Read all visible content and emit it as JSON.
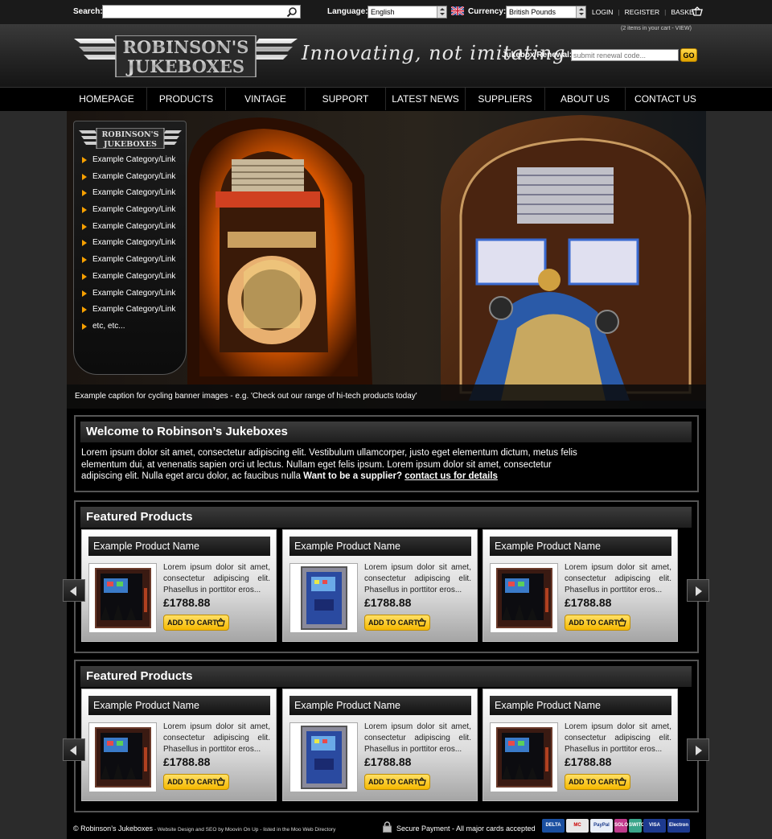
{
  "topbar": {
    "search_label": "Search:",
    "search_value": "",
    "language_label": "Language:",
    "language_value": "English",
    "currency_label": "Currency:",
    "currency_value": "British Pounds",
    "login": "LOGIN",
    "register": "REGISTER",
    "basket": "BASKET"
  },
  "header": {
    "cart_note": "(2 items in your cart - VIEW)",
    "logo_line1": "ROBINSON'S",
    "logo_line2": "JUKEBOXES",
    "tagline": "Innovating, not imitating",
    "renewal_label": "Jukebox Renewal:",
    "renewal_placeholder": "submit renewal code...",
    "go_label": "GO"
  },
  "nav": {
    "items": [
      {
        "label": "HOMEPAGE"
      },
      {
        "label": "PRODUCTS"
      },
      {
        "label": "VINTAGE"
      },
      {
        "label": "SUPPORT"
      },
      {
        "label": "LATEST NEWS"
      },
      {
        "label": "SUPPLIERS"
      },
      {
        "label": "ABOUT US"
      },
      {
        "label": "CONTACT US"
      }
    ]
  },
  "side_menu": {
    "logo_line1": "ROBINSON'S",
    "logo_line2": "JUKEBOXES",
    "items": [
      "Example Category/Link",
      "Example Category/Link",
      "Example Category/Link",
      "Example Category/Link",
      "Example Category/Link",
      "Example Category/Link",
      "Example Category/Link",
      "Example Category/Link",
      "Example Category/Link",
      "Example Category/Link",
      "etc, etc..."
    ]
  },
  "banner": {
    "caption": "Example caption for cycling banner images - e.g. 'Check out our range of hi-tech products today'"
  },
  "welcome": {
    "title": "Welcome to Robinson’s Jukeboxes",
    "body": "Lorem ipsum dolor sit amet, consectetur adipiscing elit. Vestibulum ullamcorper, justo eget elementum dictum, metus felis elementum dui, at venenatis sapien orci ut lectus. Nullam eget felis ipsum. Lorem ipsum dolor sit amet, consectetur adipiscing elit. Nulla eget arcu dolor, ac faucibus nulla",
    "cta_bold": "Want to be a supplier?",
    "cta_link": "contact us for details"
  },
  "featured": [
    {
      "title": "Featured Products",
      "products": [
        {
          "name": "Example Product Name",
          "desc": "Lorem ipsum dolor sit amet, consectetur adipiscing elit. Phasellus in porttitor eros...",
          "price": "£1788.88",
          "cart": "ADD TO CART",
          "image": "dark-jukebox"
        },
        {
          "name": "Example Product Name",
          "desc": "Lorem ipsum dolor sit amet, consectetur adipiscing elit. Phasellus in porttitor eros...",
          "price": "£1788.88",
          "cart": "ADD TO CART",
          "image": "blue-jukebox"
        },
        {
          "name": "Example Product Name",
          "desc": "Lorem ipsum dolor sit amet, consectetur adipiscing elit. Phasellus in porttitor eros...",
          "price": "£1788.88",
          "cart": "ADD TO CART",
          "image": "dark-jukebox"
        }
      ]
    },
    {
      "title": "Featured Products",
      "products": [
        {
          "name": "Example Product Name",
          "desc": "Lorem ipsum dolor sit amet, consectetur adipiscing elit. Phasellus in porttitor eros...",
          "price": "£1788.88",
          "cart": "ADD TO CART",
          "image": "dark-jukebox"
        },
        {
          "name": "Example Product Name",
          "desc": "Lorem ipsum dolor sit amet, consectetur adipiscing elit. Phasellus in porttitor eros...",
          "price": "£1788.88",
          "cart": "ADD TO CART",
          "image": "blue-jukebox"
        },
        {
          "name": "Example Product Name",
          "desc": "Lorem ipsum dolor sit amet, consectetur adipiscing elit. Phasellus in porttitor eros...",
          "price": "£1788.88",
          "cart": "ADD TO CART",
          "image": "dark-jukebox"
        }
      ]
    }
  ],
  "footer": {
    "copyright": "© Robinson’s Jukeboxes",
    "credits": " - Website Design and SEO by Moovin On Up - listed in the Moo Web Directory",
    "secure": "Secure Payment - All major cards accepted",
    "cards": [
      {
        "name": "DELTA",
        "color": "#1a4fa0"
      },
      {
        "name": "MC",
        "color": "#e8e8e8"
      },
      {
        "name": "PayPal",
        "color": "#e8eef8"
      },
      {
        "name": "SOLO",
        "color": "#c03b8c"
      },
      {
        "name": "SWITCH",
        "color": "#3aa58a"
      },
      {
        "name": "VISA",
        "color": "#1d3a8f"
      },
      {
        "name": "Electron",
        "color": "#1d3a8f"
      }
    ]
  },
  "colors": {
    "accent": "#f7a000",
    "button_yellow": "#f5b800",
    "background": "#2b2b2b"
  }
}
